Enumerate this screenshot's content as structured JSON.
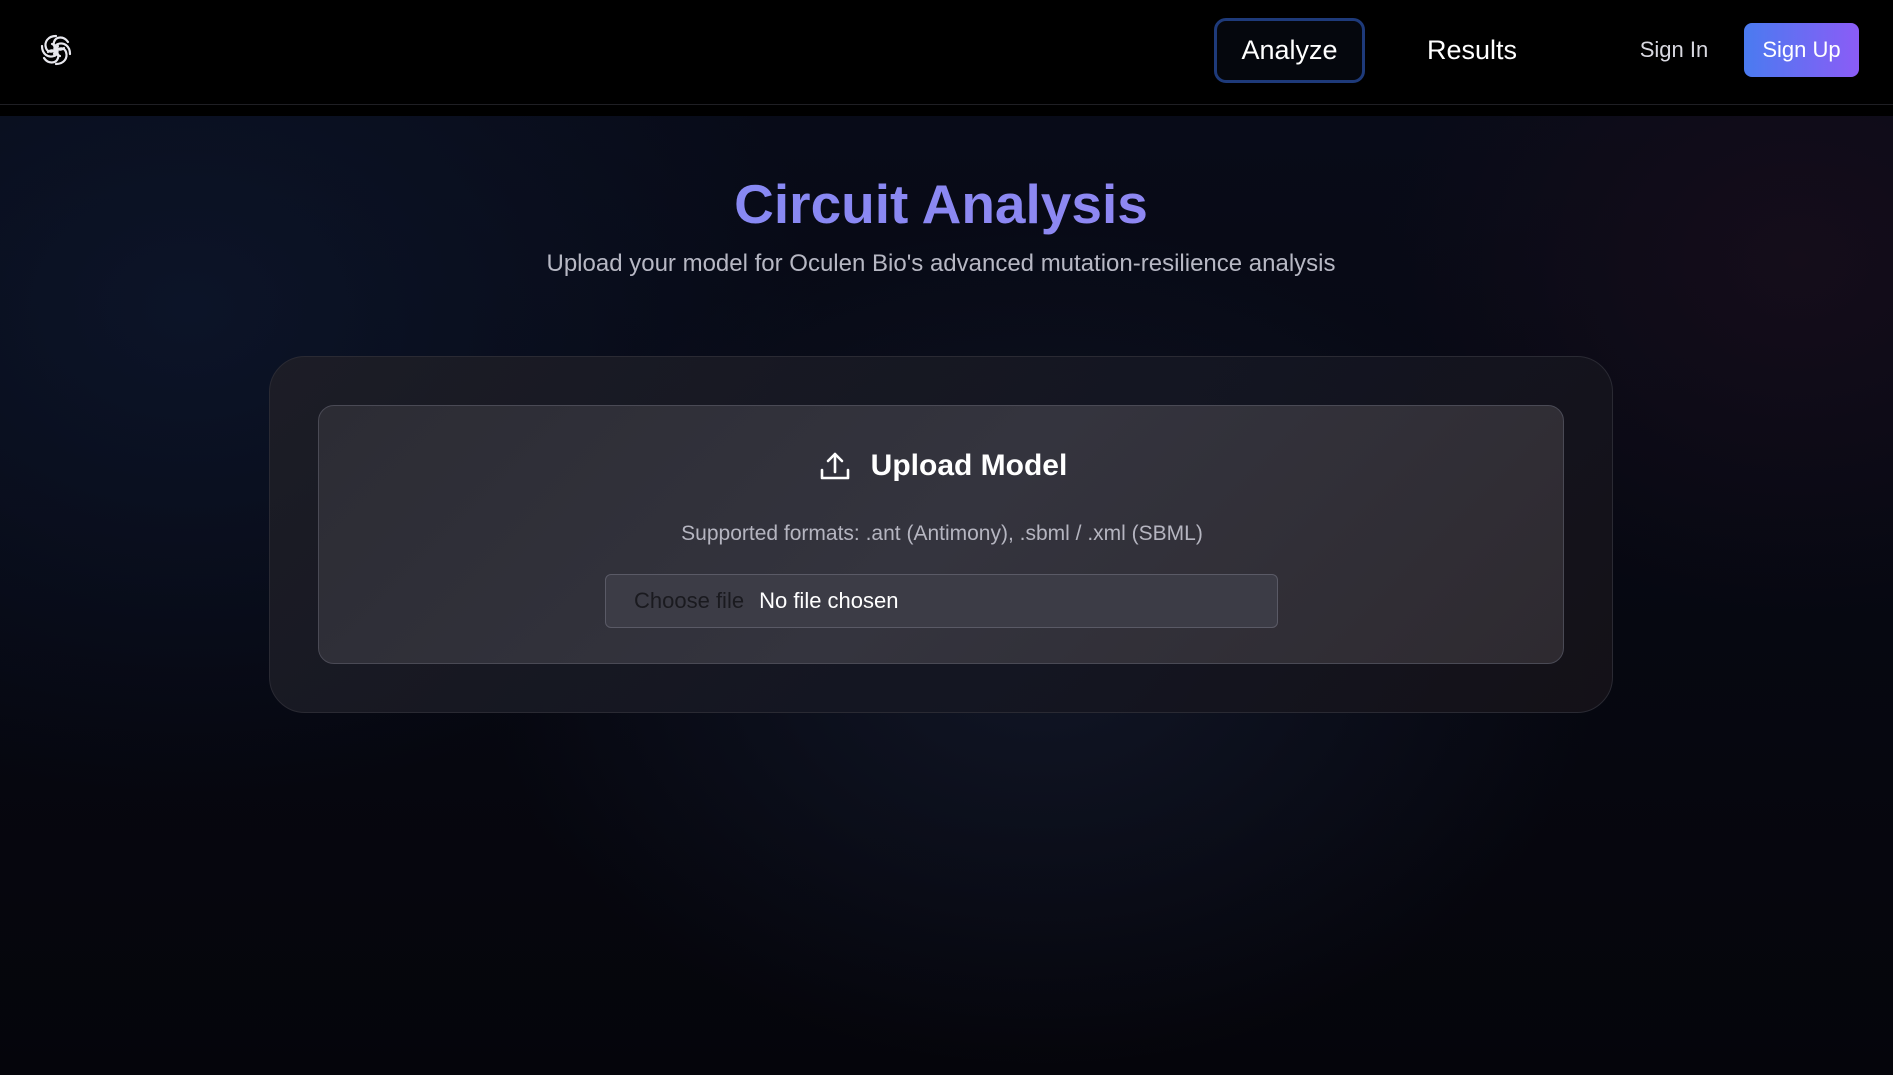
{
  "nav": {
    "logo": "logo-icon",
    "tabs": [
      {
        "label": "Analyze",
        "active": true
      },
      {
        "label": "Results",
        "active": false
      }
    ],
    "sign_in": "Sign In",
    "sign_up": "Sign Up"
  },
  "main": {
    "title": "Circuit Analysis",
    "subtitle": "Upload your model for Oculen Bio's advanced mutation-resilience analysis",
    "upload": {
      "icon": "upload-icon",
      "title": "Upload Model",
      "formats": "Supported formats: .ant (Antimony), .sbml / .xml (SBML)",
      "choose_file": "Choose file",
      "file_status": "No file chosen"
    }
  },
  "colors": {
    "accent_gradient_start": "#4a7bf0",
    "accent_gradient_end": "#8b5cf6",
    "title_color": "#8a8af2",
    "active_tab_border": "#1e3a7a"
  }
}
